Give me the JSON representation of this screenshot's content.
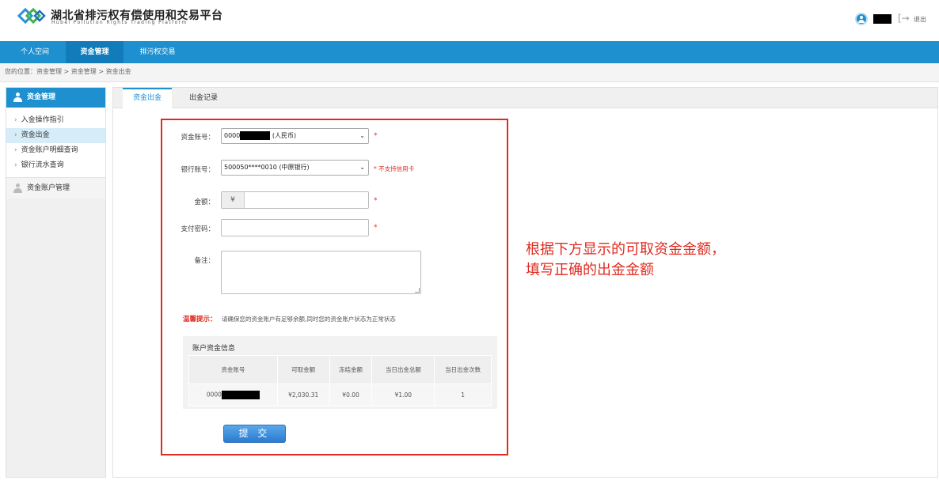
{
  "header": {
    "brand_cn": "湖北省排污权有偿使用和交易平台",
    "brand_en": "Hubei Pollution Rights Trading Platform",
    "logout": "退出"
  },
  "nav": {
    "items": [
      {
        "label": "个人空间"
      },
      {
        "label": "资金管理"
      },
      {
        "label": "排污权交易"
      }
    ]
  },
  "breadcrumb": "您的位置：资金管理 > 资金管理 > 资金出金",
  "sidebar": {
    "head": "资金管理",
    "items": [
      {
        "label": "入金操作指引"
      },
      {
        "label": "资金出金"
      },
      {
        "label": "资金账户明细查询"
      },
      {
        "label": "银行流水查询"
      }
    ],
    "sub": "资金账户管理"
  },
  "tabs": [
    {
      "label": "资金出金"
    },
    {
      "label": "出金记录"
    }
  ],
  "form": {
    "account_label": "资金账号：",
    "account_prefix": "0000",
    "account_suffix": "(人民币)",
    "bank_label": "银行账号：",
    "bank_value": "500050****0010 (中原银行)",
    "bank_note": "* 不支持信用卡",
    "amount_label": "金额：",
    "currency": "¥",
    "password_label": "支付密码：",
    "remark_label": "备注：",
    "required": "*",
    "tip_label": "温馨提示：",
    "tip_text": "请确保您的资金账户有足够余额,同时您的资金账户状态为正常状态",
    "submit": "提 交"
  },
  "info": {
    "title": "账户资金信息",
    "columns": [
      "资金账号",
      "可取金额",
      "冻结金额",
      "当日出金总额",
      "当日出金次数"
    ],
    "row": {
      "account_prefix": "0000",
      "available": "¥2,030.31",
      "frozen": "¥0.00",
      "today_total": "¥1.00",
      "today_count": "1"
    }
  },
  "annotation": {
    "line1": "根据下方显示的可取资金金额，",
    "line2": "填写正确的出金金额"
  },
  "colors": {
    "primary": "#1e90d0",
    "highlight": "#e02b20"
  }
}
